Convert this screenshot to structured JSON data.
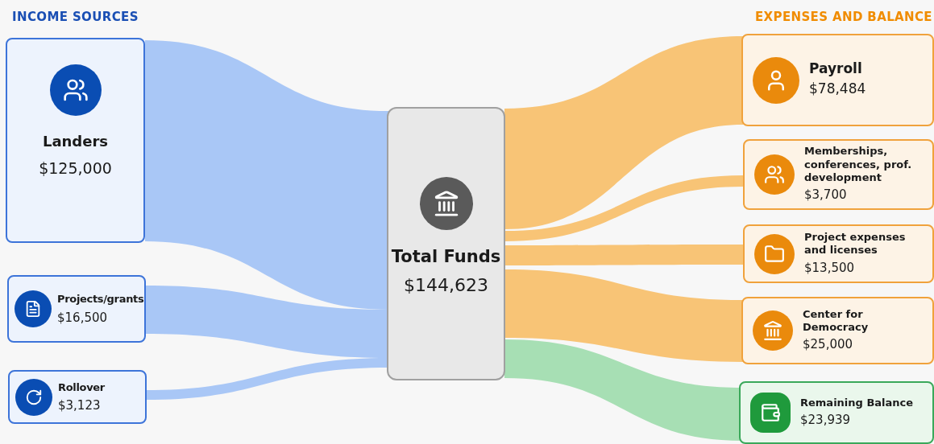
{
  "income": {
    "title": "INCOME SOURCES",
    "sources": [
      {
        "name": "Landers",
        "amount": "$125,000"
      },
      {
        "name": "Projects/grants",
        "amount": "$16,500"
      },
      {
        "name": "Rollover",
        "amount": "$3,123"
      }
    ]
  },
  "total": {
    "name": "Total Funds",
    "amount": "$144,623"
  },
  "expenses": {
    "title": "EXPENSES AND BALANCE",
    "items": [
      {
        "kind": "expense",
        "name": "Payroll",
        "amount": "$78,484"
      },
      {
        "kind": "expense",
        "name": "Memberships, conferences, prof. development",
        "amount": "$3,700"
      },
      {
        "kind": "expense",
        "name": "Project expenses and licenses",
        "amount": "$13,500"
      },
      {
        "kind": "expense",
        "name": "Center for Democracy",
        "amount": "$25,000"
      },
      {
        "kind": "balance",
        "name": "Remaining Balance",
        "amount": "$23,939"
      }
    ]
  }
}
